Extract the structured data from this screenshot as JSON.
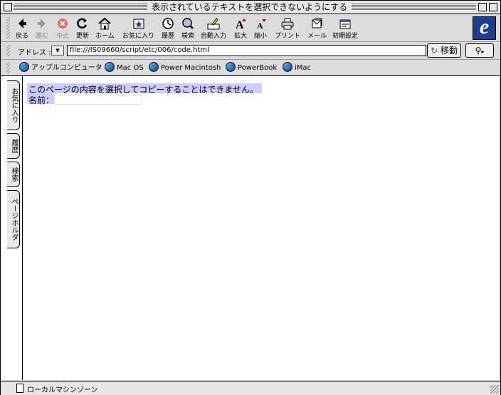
{
  "window": {
    "title": "表示されているテキストを選択できないようにする"
  },
  "toolbar": {
    "buttons": [
      {
        "label": "戻る",
        "icon": "back-arrow-icon"
      },
      {
        "label": "進む",
        "icon": "forward-arrow-icon"
      },
      {
        "label": "中止",
        "icon": "stop-icon"
      },
      {
        "label": "更新",
        "icon": "refresh-icon"
      },
      {
        "label": "ホーム",
        "icon": "home-icon"
      },
      {
        "label": "お気に入り",
        "icon": "favorites-icon"
      },
      {
        "label": "履歴",
        "icon": "history-icon"
      },
      {
        "label": "検索",
        "icon": "search-icon"
      },
      {
        "label": "自動入力",
        "icon": "autofill-icon"
      },
      {
        "label": "拡大",
        "icon": "text-larger-icon"
      },
      {
        "label": "縮小",
        "icon": "text-smaller-icon"
      },
      {
        "label": "プリント",
        "icon": "print-icon"
      },
      {
        "label": "メール",
        "icon": "mail-icon"
      },
      {
        "label": "初期設定",
        "icon": "preferences-icon"
      }
    ],
    "logo": "e"
  },
  "address": {
    "label": "アドレス :",
    "url": "file:///IS09660/script/etc/006/code.html",
    "go_label": "移動"
  },
  "bookmarks": [
    {
      "label": "アップルコンピュータ"
    },
    {
      "label": "Mac OS"
    },
    {
      "label": "Power Macintosh"
    },
    {
      "label": "PowerBook"
    },
    {
      "label": "iMac"
    }
  ],
  "sidebar_tabs": [
    {
      "label": "お気に入り"
    },
    {
      "label": "履歴"
    },
    {
      "label": "検索"
    },
    {
      "label": "ページホルダ"
    }
  ],
  "page": {
    "text": "このページの内容を選択してコピーすることはできません。",
    "name_label": "名前：",
    "name_value": ""
  },
  "status": {
    "zone": "ローカルマシンゾーン"
  },
  "colors": {
    "selection": "#ccccff",
    "chrome": "#dddddd",
    "logo_bg": "#1b3e8c"
  }
}
